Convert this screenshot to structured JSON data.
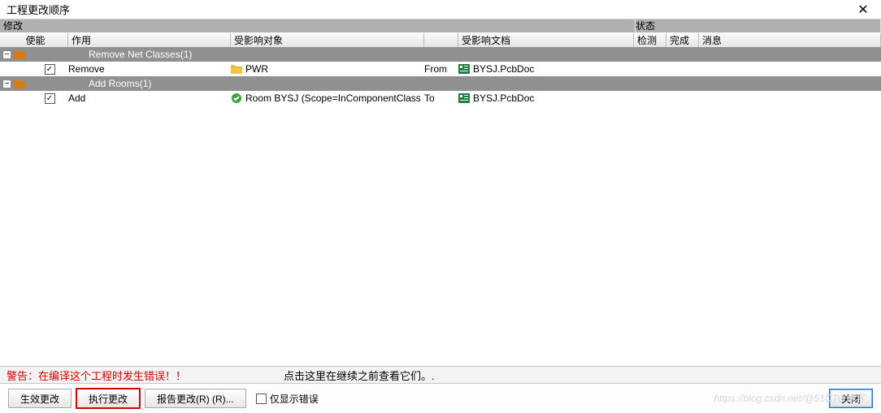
{
  "window": {
    "title": "工程更改顺序"
  },
  "section_headers": {
    "left": "修改",
    "right": "状态"
  },
  "columns": {
    "enable": "使能",
    "action": "作用",
    "affected_object": "受影响对象",
    "spacer": "",
    "affected_doc": "受影响文档",
    "check": "检测",
    "done": "完成",
    "msg": "消息"
  },
  "groups": [
    {
      "title": "Remove Net Classes(1)",
      "items": [
        {
          "checked": true,
          "action": "Remove",
          "obj_icon": "folder",
          "obj": "PWR",
          "rel": "From",
          "doc": "BYSJ.PcbDoc"
        }
      ]
    },
    {
      "title": "Add Rooms(1)",
      "items": [
        {
          "checked": true,
          "action": "Add",
          "obj_icon": "check-green",
          "obj": "Room BYSJ (Scope=InComponentClass",
          "rel": "To",
          "doc": "BYSJ.PcbDoc"
        }
      ]
    }
  ],
  "warning": {
    "text": "警告：在编译这个工程时发生错误！！",
    "hint": "点击这里在继续之前查看它们。."
  },
  "buttons": {
    "validate": "生效更改",
    "execute": "执行更改",
    "report": "报告更改(R) (R)...",
    "only_errors": "仅显示错误",
    "close": "关闭"
  },
  "watermark": "https://blog.csdn.net/@51CTO博客"
}
